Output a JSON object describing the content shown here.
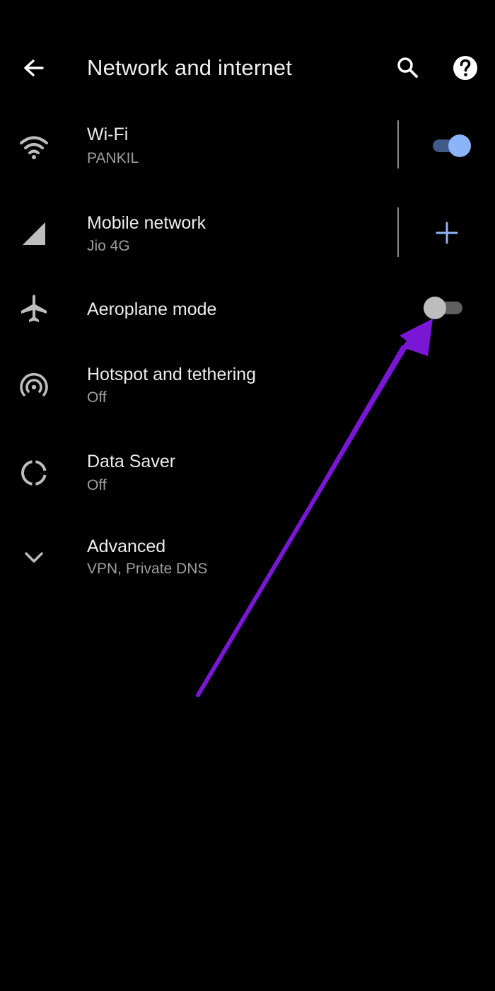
{
  "appbar": {
    "title": "Network and internet",
    "back_icon": "arrow-left-icon",
    "search_icon": "search-icon",
    "help_icon": "help-circle-icon"
  },
  "items": [
    {
      "label": "Wi-Fi",
      "sub": "PANKIL",
      "icon": "wifi-icon",
      "control": "toggle",
      "state": "on"
    },
    {
      "label": "Mobile network",
      "sub": "Jio 4G",
      "icon": "signal-icon",
      "control": "add",
      "state": null
    },
    {
      "label": "Aeroplane mode",
      "sub": "",
      "icon": "airplane-icon",
      "control": "toggle",
      "state": "off"
    },
    {
      "label": "Hotspot and tethering",
      "sub": "Off",
      "icon": "hotspot-icon",
      "control": null,
      "state": null
    },
    {
      "label": "Data Saver",
      "sub": "Off",
      "icon": "data-saver-icon",
      "control": null,
      "state": null
    },
    {
      "label": "Advanced",
      "sub": "VPN, Private DNS",
      "icon": "chevron-down-icon",
      "control": null,
      "state": null
    }
  ],
  "colors": {
    "background": "#000000",
    "accent": "#7aa7f5",
    "annotation_arrow": "#7a16d6"
  }
}
